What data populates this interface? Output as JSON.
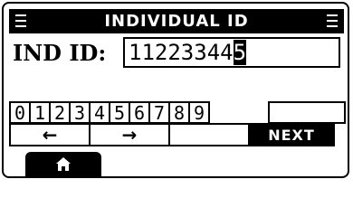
{
  "titlebar": {
    "title": "INDIVIDUAL ID"
  },
  "id_entry": {
    "label": "IND ID:",
    "value_entered": "11223344",
    "value_cursor": "5"
  },
  "keypad": {
    "digits": [
      "0",
      "1",
      "2",
      "3",
      "4",
      "5",
      "6",
      "7",
      "8",
      "9"
    ],
    "left_arrow": "←",
    "right_arrow": "→",
    "next_label": "NEXT"
  },
  "icons": {
    "menu_left": "menu-icon",
    "menu_right": "menu-icon",
    "home": "home-icon"
  }
}
